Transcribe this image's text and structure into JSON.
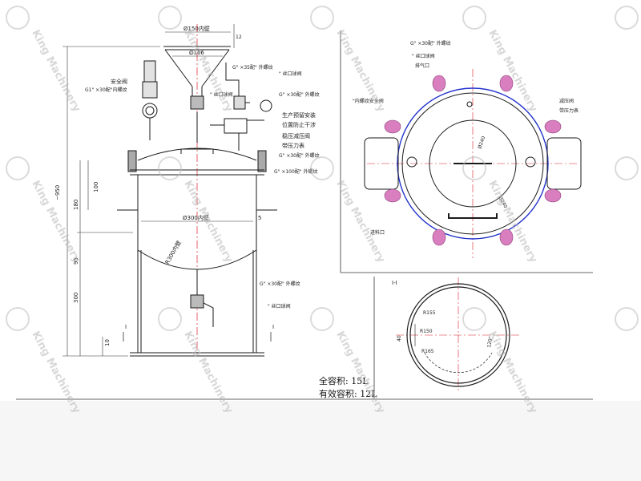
{
  "colors": {
    "line": "#1a1a1a",
    "center_line": "#d8222c",
    "blue_line": "#2233cc",
    "fitting_pink": "#d97fc0",
    "watermark": "#bdbdbd",
    "paper": "#ffffff"
  },
  "watermark": {
    "brand": "King Machinery",
    "logo_icon": "kt-logo-icon"
  },
  "front_view": {
    "dims": {
      "top_width": "Ø150内壁",
      "funnel": "Ø166",
      "top_thk": "12",
      "vessel": "Ø300内壁",
      "overall_h": "~950",
      "h180": "180",
      "h100": "100",
      "h95": "95",
      "h300": "300",
      "h10": "10",
      "r_bottom": "R300内壁",
      "five": "5"
    },
    "labels": {
      "safety_valve": "安全阀",
      "g1": "G1\" ×30配\"内螺纹",
      "g_ext35": "G\" ×35配\" 外螺纹",
      "wire_valve_a": "\" 丝口球阀",
      "wire_valve_b": "\" 丝口球阀",
      "g_ext30": "G\" ×30配\" 外螺纹",
      "install_note1": "生产预留安装",
      "install_note2": "位置防止干涉",
      "regulator": "稳压减压阀",
      "with_gauge": "带压力表",
      "g_ext30b": "G\" ×30配\" 外螺纹",
      "g_ext100": "G\" ×100配\" 外螺纹",
      "g_ext30c": "G\" ×30配\" 外螺纹",
      "wire_valve_c": "\" 丝口球阀",
      "section_mark": "I"
    }
  },
  "top_view": {
    "labels": {
      "g_ext_top": "G\" ×30配\" 外螺纹",
      "wire_valve": "\" 丝口球阀",
      "vent": "排气口",
      "internal_safety": "\"内螺纹安全阀",
      "reducer": "减压阀",
      "with_gauge": "带压力表",
      "inlet": "进料口",
      "d240": "Ø240",
      "d240b": "Ø240"
    }
  },
  "section_view": {
    "title": "I-I",
    "dims": {
      "r155": "R155",
      "r150": "R150",
      "r165": "R165",
      "d40": "40",
      "a120": "120°"
    }
  },
  "spec": {
    "total_volume": "全容积: 15L",
    "effective_volume": "有效容积: 12L"
  }
}
